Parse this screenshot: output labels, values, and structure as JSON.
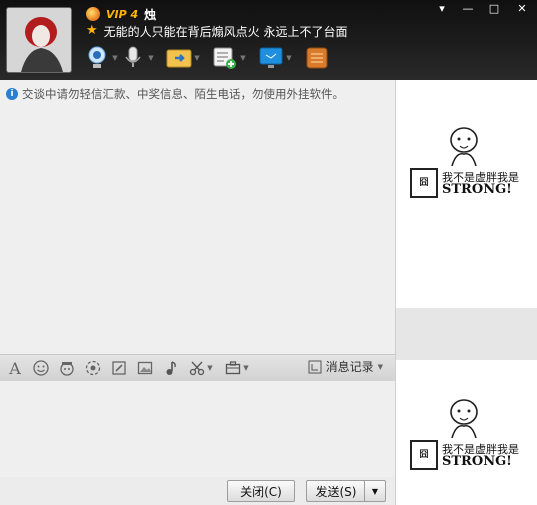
{
  "profile": {
    "vip_label": "VIP 4",
    "nickname": "烛",
    "signature": "无能的人只能在背后煽风点火 永远上不了台面"
  },
  "window_controls": {
    "menu": "▾",
    "minimize": "—",
    "maximize": "□",
    "close": "✕"
  },
  "top_toolbar": {
    "items": [
      "video-call",
      "voice-call",
      "send-file",
      "create-discussion",
      "remote-assist",
      "app-box"
    ]
  },
  "chat": {
    "notice": "交谈中请勿轻信汇款、中奖信息、陌生电话，勿使用外挂软件。"
  },
  "input_toolbar": {
    "history_label": "消息记录"
  },
  "buttons": {
    "close_label": "关闭(C)",
    "send_label": "发送(S)"
  },
  "right_panel": {
    "memes": [
      {
        "seal": "囧",
        "line1": "我不是虚胖我是",
        "line2": "STRONG!"
      },
      {
        "seal": "囧",
        "line1": "我不是虚胖我是",
        "line2": "STRONG!"
      }
    ]
  },
  "colors": {
    "header_bg": "#151515",
    "vip_gold": "#ffb400",
    "info_blue": "#2a7fd0"
  }
}
